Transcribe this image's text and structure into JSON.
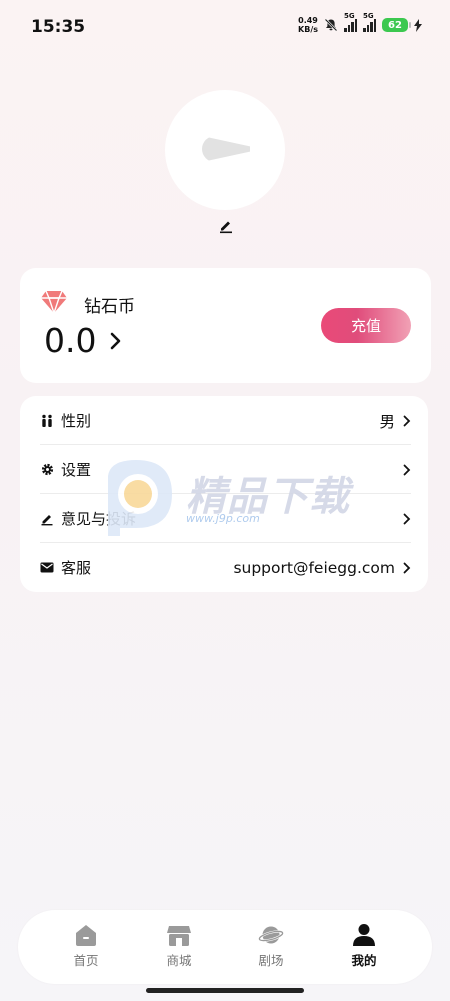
{
  "status_bar": {
    "time": "15:35",
    "net_speed_value": "0.49",
    "net_speed_unit": "KB/s",
    "signal1_label": "5G",
    "signal2_label": "5G",
    "battery": "62"
  },
  "profile": {
    "avatar_icon": "avatar-placeholder",
    "edit_icon": "pencil-icon"
  },
  "wallet": {
    "title": "钻石币",
    "balance": "0.0",
    "recharge_label": "充值",
    "accent_color": "#e9477a"
  },
  "settings": {
    "items": [
      {
        "label": "性别",
        "value": "男",
        "icon": "gender-icon"
      },
      {
        "label": "设置",
        "value": "",
        "icon": "gear-icon"
      },
      {
        "label": "意见与投诉",
        "value": "",
        "icon": "pencil-icon"
      },
      {
        "label": "客服",
        "value": "support@feiegg.com",
        "icon": "mail-icon"
      }
    ]
  },
  "watermark": {
    "text": "精品下载",
    "url": "www.j9p.com"
  },
  "nav": {
    "items": [
      {
        "label": "首页",
        "icon": "home-icon"
      },
      {
        "label": "商城",
        "icon": "shop-icon"
      },
      {
        "label": "剧场",
        "icon": "planet-icon"
      },
      {
        "label": "我的",
        "icon": "user-icon"
      }
    ],
    "active": "我的"
  }
}
